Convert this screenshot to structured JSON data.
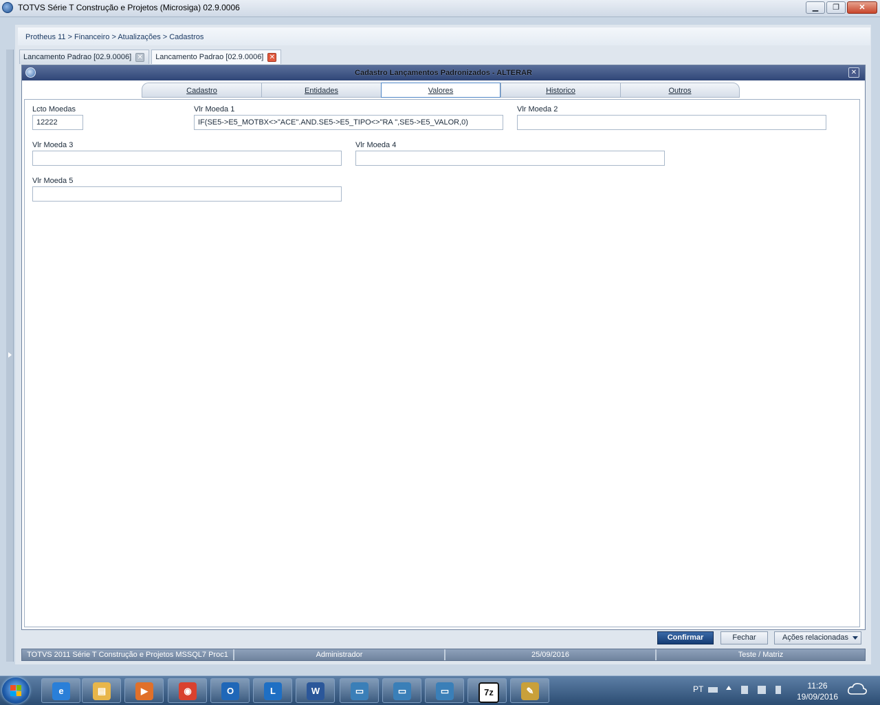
{
  "window": {
    "title": "TOTVS Série T Construção e Projetos (Microsiga) 02.9.0006",
    "minimize_label": "▁",
    "restore_label": "❐",
    "close_label": "✕"
  },
  "breadcrumb": "Protheus 11 > Financeiro > Atualizações > Cadastros",
  "doc_tabs": [
    {
      "label": "Lancamento Padrao [02.9.0006]",
      "close": "✕"
    },
    {
      "label": "Lancamento Padrao [02.9.0006]",
      "close": "✕"
    }
  ],
  "dialog": {
    "title": "Cadastro Lançamentos Padronizados - ALTERAR",
    "close_label": "✕"
  },
  "section_tabs": [
    "Cadastro",
    "Entidades",
    "Valores",
    "Historico",
    "Outros"
  ],
  "active_section_tab": "Valores",
  "fields": {
    "lcto_moedas": {
      "label": "Lcto Moedas",
      "value": "12222"
    },
    "vlr_moeda_1": {
      "label": "Vlr Moeda 1",
      "value": "IF(SE5->E5_MOTBX<>\"ACE\".AND.SE5->E5_TIPO<>\"RA \",SE5->E5_VALOR,0)"
    },
    "vlr_moeda_2": {
      "label": "Vlr Moeda 2",
      "value": ""
    },
    "vlr_moeda_3": {
      "label": "Vlr Moeda 3",
      "value": ""
    },
    "vlr_moeda_4": {
      "label": "Vlr Moeda 4",
      "value": ""
    },
    "vlr_moeda_5": {
      "label": "Vlr Moeda 5",
      "value": ""
    }
  },
  "buttons": {
    "confirm": "Confirmar",
    "close": "Fechar",
    "actions": "Ações relacionadas"
  },
  "status_bar": {
    "system": "TOTVS 2011 Série T Construção e Projetos MSSQL7 Proc1",
    "user": "Administrador",
    "date": "25/09/2016",
    "company": "Teste / Matriz"
  },
  "taskbar": {
    "apps": [
      {
        "icon": "internet-explorer-icon",
        "glyph": "e",
        "color": "#2a7fd8"
      },
      {
        "icon": "file-explorer-icon",
        "glyph": "▤",
        "color": "#e8b64a"
      },
      {
        "icon": "media-player-icon",
        "glyph": "▶",
        "color": "#e0702a"
      },
      {
        "icon": "chrome-icon",
        "glyph": "◉",
        "color": "#d9412f"
      },
      {
        "icon": "outlook-icon",
        "glyph": "O",
        "color": "#1f67b8"
      },
      {
        "icon": "lync-icon",
        "glyph": "L",
        "color": "#1e6fc4"
      },
      {
        "icon": "word-icon",
        "glyph": "W",
        "color": "#2b579a"
      },
      {
        "icon": "remote-desktop-icon",
        "glyph": "▭",
        "color": "#3a7fb8"
      },
      {
        "icon": "remote-desktop-icon",
        "glyph": "▭",
        "color": "#3a7fb8"
      },
      {
        "icon": "remote-desktop-icon",
        "glyph": "▭",
        "color": "#3a7fb8"
      },
      {
        "icon": "7zip-icon",
        "glyph": "7z",
        "color": "#111111"
      },
      {
        "icon": "tools-icon",
        "glyph": "✎",
        "color": "#c9a03a"
      }
    ],
    "language": "PT",
    "time": "11:26",
    "date": "19/09/2016"
  }
}
